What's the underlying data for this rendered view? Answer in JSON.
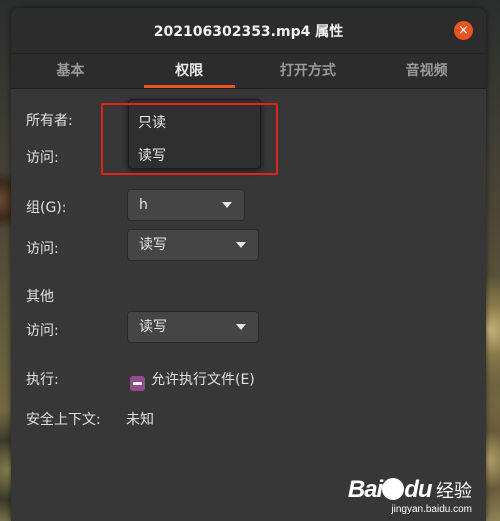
{
  "window": {
    "title": "202106302353.mp4 属性",
    "close_symbol": "×"
  },
  "tabs": [
    {
      "label": "基本",
      "active": false
    },
    {
      "label": "权限",
      "active": true
    },
    {
      "label": "打开方式",
      "active": false
    },
    {
      "label": "音视频",
      "active": false
    }
  ],
  "owner": {
    "label": "所有者:",
    "access_label": "访问:",
    "popup_options": [
      "只读",
      "读写"
    ]
  },
  "group": {
    "label": "组(G):",
    "value": "h",
    "access_label": "访问:",
    "access_value": "读写"
  },
  "others": {
    "heading": "其他",
    "access_label": "访问:",
    "access_value": "读写"
  },
  "execute": {
    "label": "执行:",
    "checkbox_label": "允许执行文件(E)",
    "checked": "mixed"
  },
  "security": {
    "label": "安全上下文:",
    "value": "未知"
  },
  "colors": {
    "accent": "#e95420",
    "annotation": "#e0231c",
    "checkbox": "#924d8b"
  },
  "watermark": {
    "brand": "Bai",
    "brand_suffix": "du",
    "service": "经验",
    "url": "jingyan.baidu.com"
  }
}
